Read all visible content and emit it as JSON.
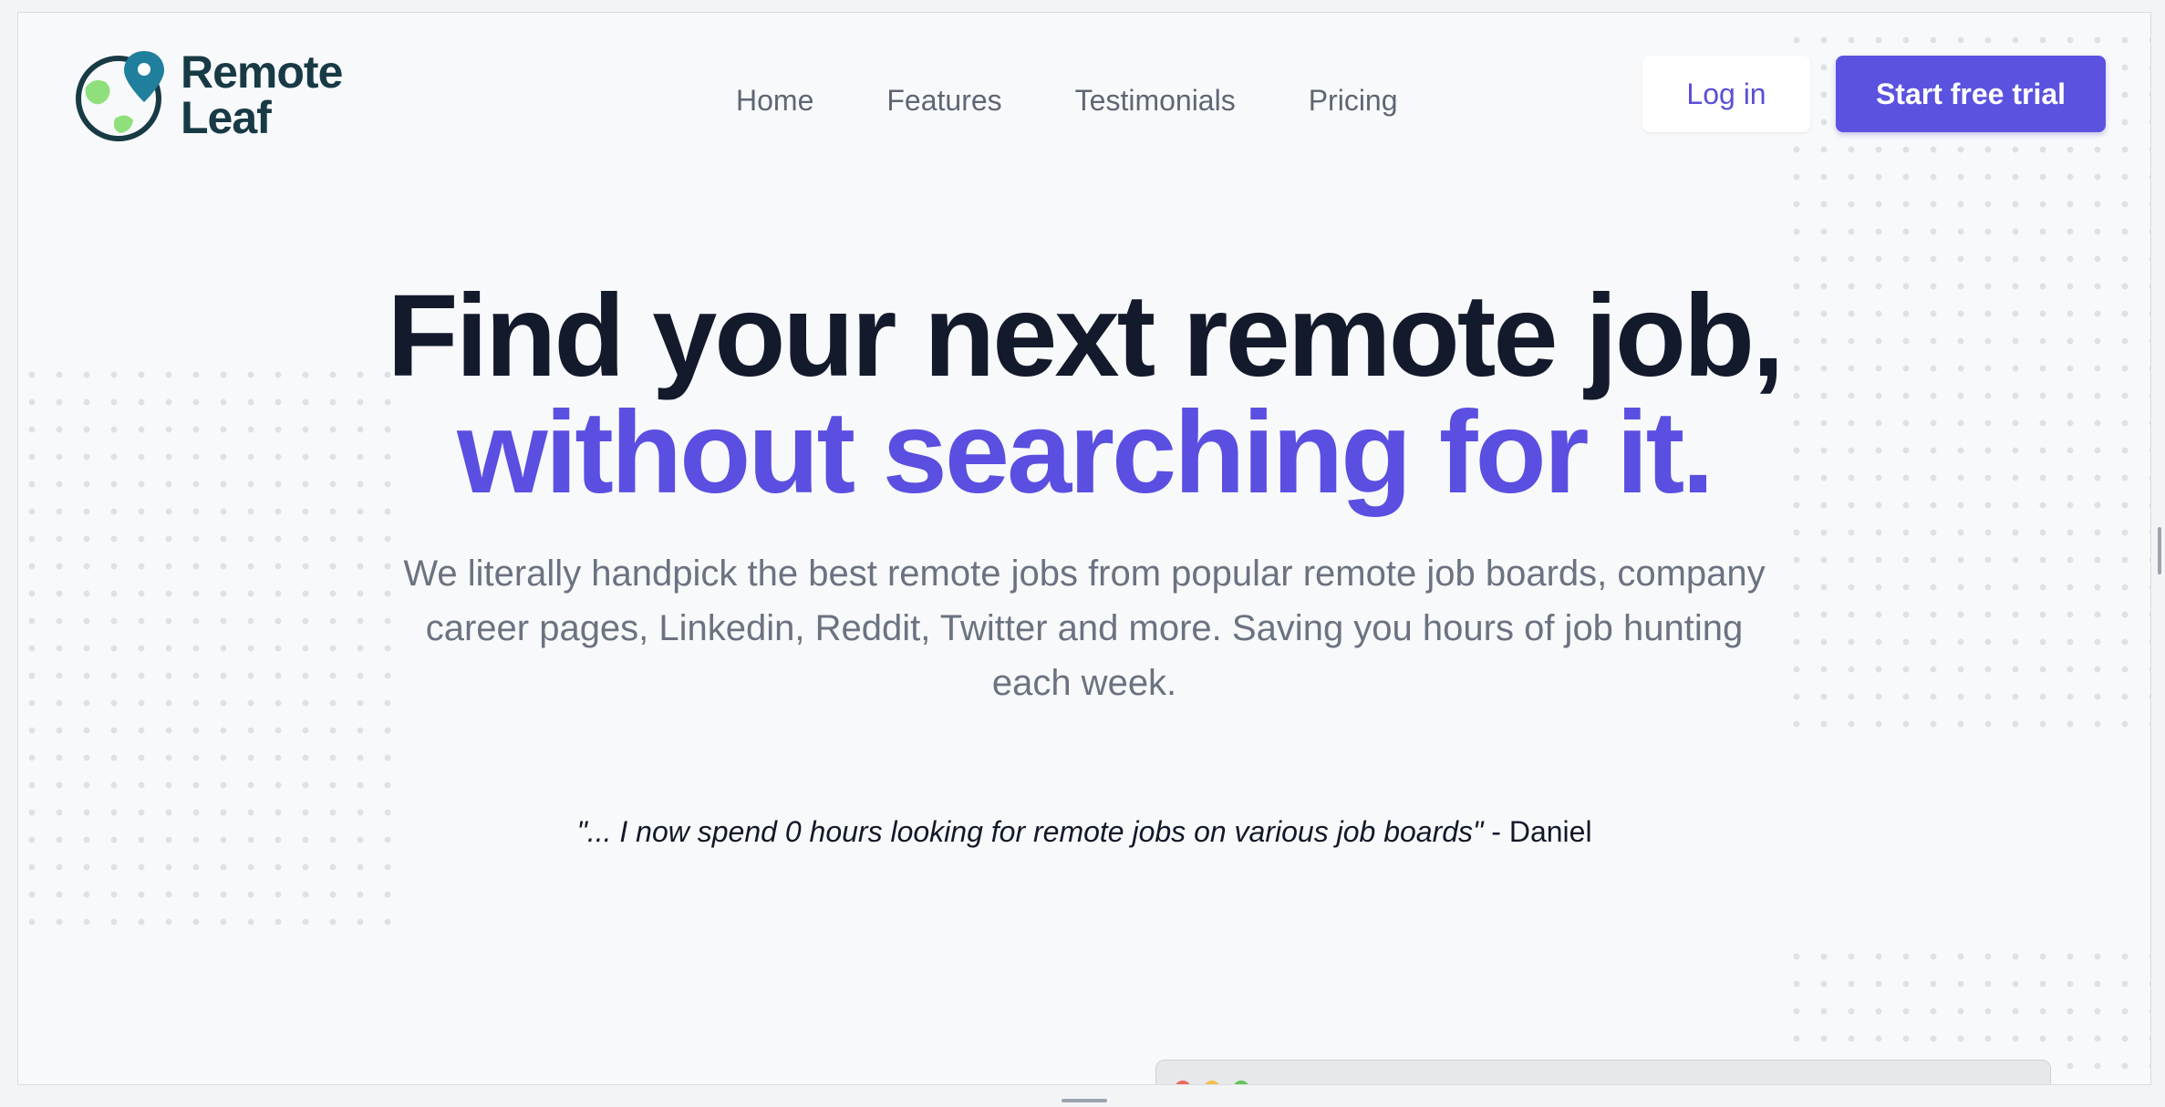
{
  "header": {
    "logo_line1": "Remote",
    "logo_line2": "Leaf",
    "nav": [
      "Home",
      "Features",
      "Testimonials",
      "Pricing"
    ],
    "login_label": "Log in",
    "trial_label": "Start free trial"
  },
  "hero": {
    "title_line1": "Find your next remote job,",
    "title_line2": "without searching for it.",
    "subtitle": "We literally handpick the best remote jobs from popular remote job boards, company career pages, Linkedin, Reddit, Twitter and more. Saving you hours of job hunting each week.",
    "quote_text": "\"... I now spend 0 hours looking for remote jobs on various job boards\"",
    "quote_author": " - Daniel"
  },
  "colors": {
    "brand": "#5b52e0",
    "logo_text": "#173a45",
    "heading": "#131a2b"
  },
  "icons": {
    "logo": "globe-pin-icon"
  }
}
